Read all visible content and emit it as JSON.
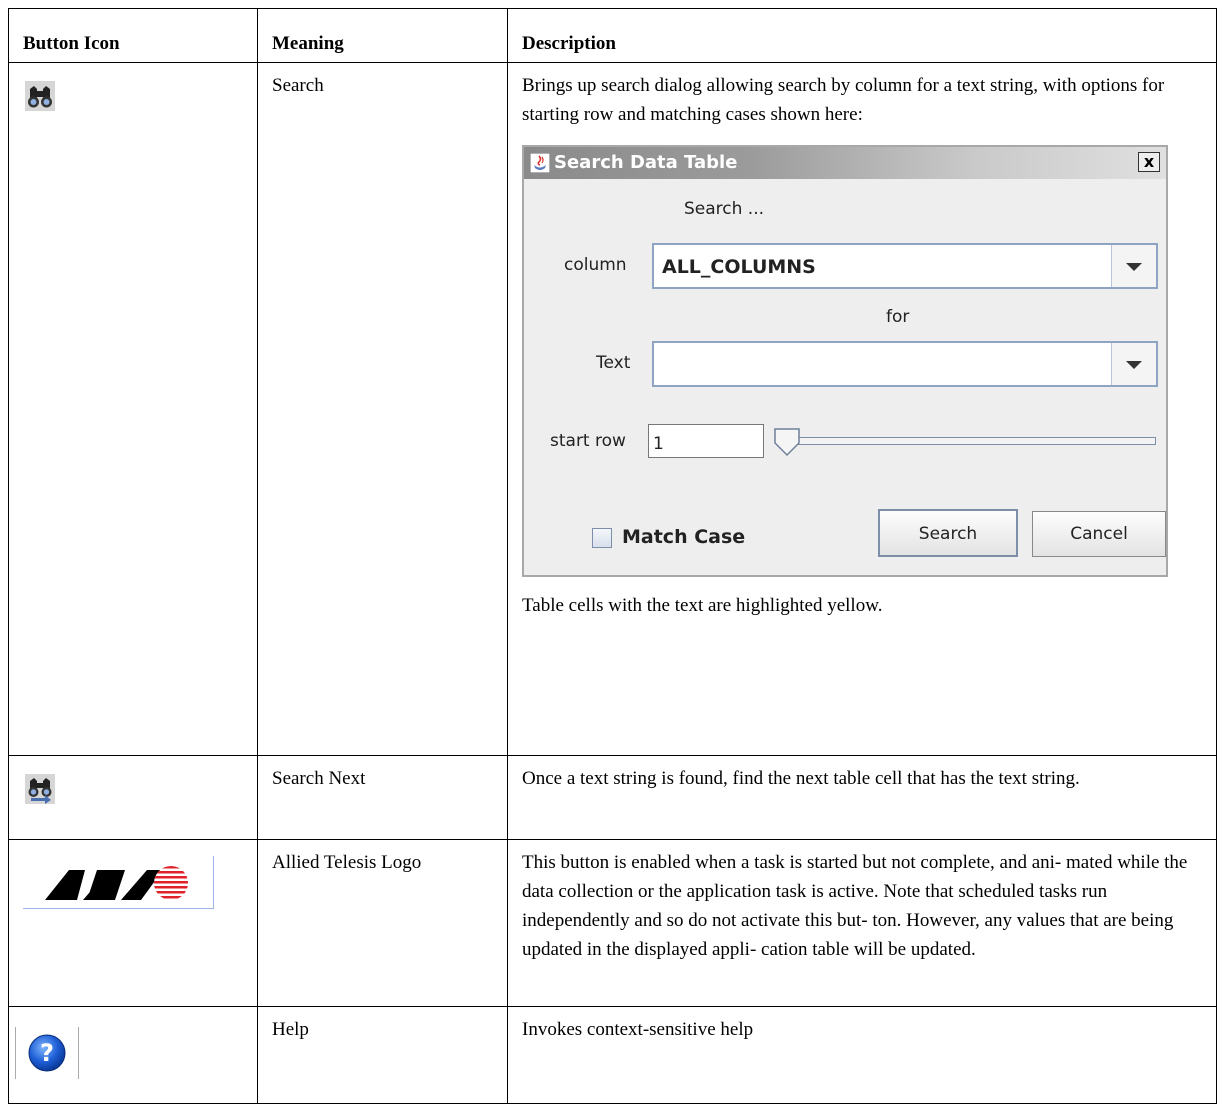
{
  "headers": {
    "icon": "Button Icon",
    "meaning": "Meaning",
    "description": "Description"
  },
  "rows": [
    {
      "icon": "binoculars-icon",
      "meaning": "Search",
      "description": "Brings up search dialog allowing search by column for a text string, with options for starting row and matching cases shown here:",
      "footer": "Table cells with the text are highlighted yellow."
    },
    {
      "icon": "binoculars-next-icon",
      "meaning": "Search Next",
      "description": "Once a text string is found, find the next table cell that has the text string."
    },
    {
      "icon": "allied-telesis-logo",
      "meaning": "Allied Telesis Logo",
      "description": "This button is enabled when a task is started but not complete, and ani- mated while the data collection or the application task is active. Note that scheduled tasks run independently and so do not activate this but- ton. However, any values that are being updated in the displayed appli- cation table will be updated."
    },
    {
      "icon": "help-icon",
      "meaning": "Help",
      "description": "Invokes context-sensitive help"
    }
  ],
  "dialog": {
    "title": "Search Data Table",
    "close_label": "x",
    "heading": "Search ...",
    "column_label": "column",
    "column_value": "ALL_COLUMNS",
    "for_label": "for",
    "text_label": "Text",
    "text_value": "",
    "start_row_label": "start row",
    "start_row_value": "1",
    "slider_value": 0,
    "match_case_label": "Match Case",
    "match_case_checked": false,
    "search_button": "Search",
    "cancel_button": "Cancel"
  }
}
